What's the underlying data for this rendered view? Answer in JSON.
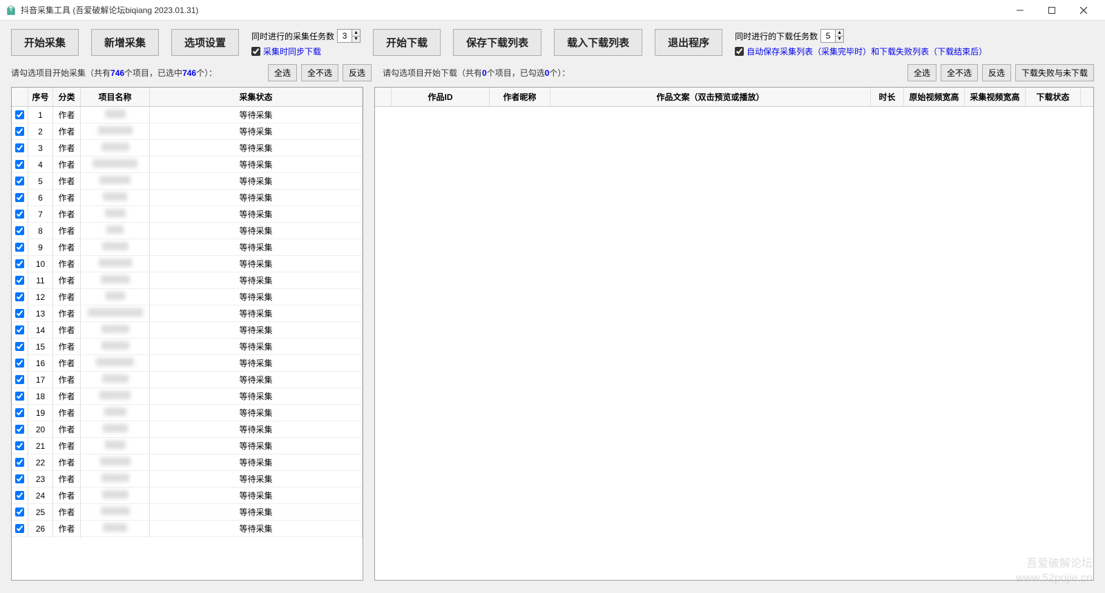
{
  "titlebar": {
    "title": "抖音采集工具 (吾爱破解论坛biqiang 2023.01.31)"
  },
  "toolbar": {
    "start_collect": "开始采集",
    "new_collect": "新增采集",
    "options": "选项设置",
    "collect_tasks_label": "同时进行的采集任务数",
    "collect_tasks_value": "3",
    "sync_download_label": "采集时同步下载",
    "start_download": "开始下载",
    "save_list": "保存下载列表",
    "load_list": "载入下载列表",
    "exit": "退出程序",
    "download_tasks_label": "同时进行的下载任务数",
    "download_tasks_value": "5",
    "autosave_label": "自动保存采集列表（采集完毕时）和下载失败列表（下载结束后）"
  },
  "infobar": {
    "left_prefix": "请勾选项目开始采集（共有",
    "left_total": "746",
    "left_mid": "个项目，已选中",
    "left_selected": "746",
    "left_suffix": "个）：",
    "select_all": "全选",
    "select_none": "全不选",
    "invert": "反选",
    "right_prefix": "请勾选项目开始下载（共有",
    "right_total": "0",
    "right_mid": "个项目，已勾选",
    "right_selected": "0",
    "right_suffix": "个）：",
    "dl_fail": "下载失败与未下载"
  },
  "left_table": {
    "headers": {
      "idx": "序号",
      "cat": "分类",
      "name": "项目名称",
      "status": "采集状态"
    },
    "row_cat": "作者",
    "row_status": "等待采集",
    "rows": [
      1,
      2,
      3,
      4,
      5,
      6,
      7,
      8,
      9,
      10,
      11,
      12,
      13,
      14,
      15,
      16,
      17,
      18,
      19,
      20,
      21,
      22,
      23,
      24,
      25,
      26
    ]
  },
  "right_table": {
    "headers": {
      "id": "作品ID",
      "author": "作者昵称",
      "text": "作品文案（双击预览或播放）",
      "dur": "时长",
      "src": "原始视频宽高",
      "col": "采集视频宽高",
      "dl": "下载状态"
    }
  },
  "watermark": {
    "line1": "吾爱破解论坛",
    "line2": "www.52pojie.cn"
  }
}
